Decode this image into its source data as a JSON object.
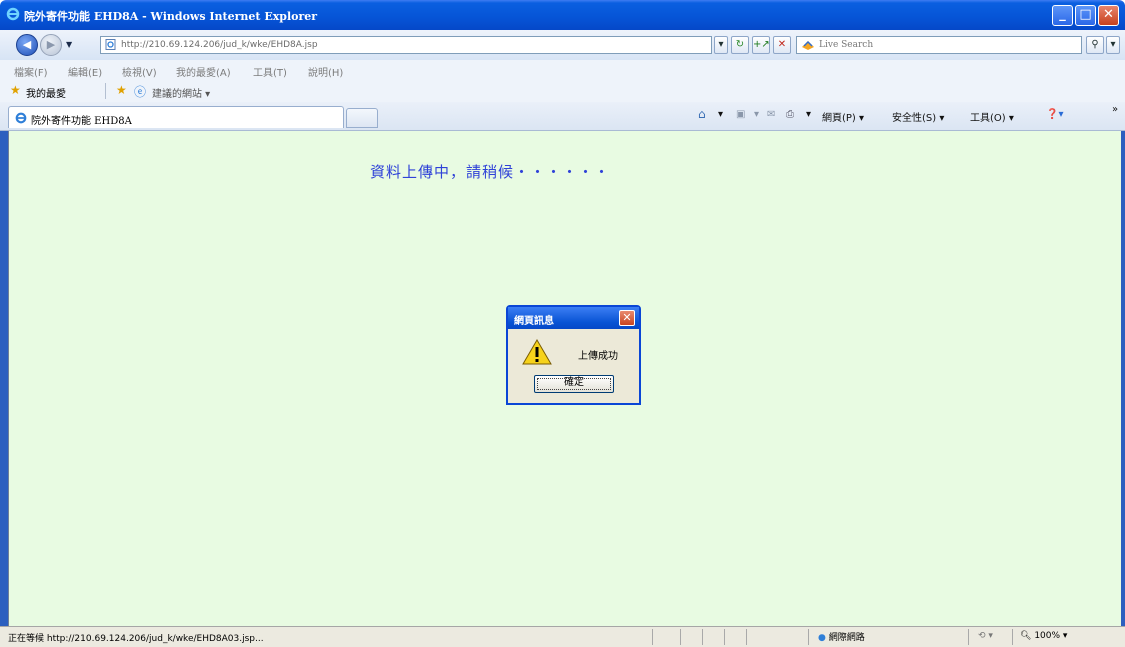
{
  "window": {
    "title": "院外寄件功能 EHD8A - Windows Internet Explorer",
    "minimize_label": "_",
    "maximize_label": "□",
    "close_label": "✕"
  },
  "address_bar": {
    "url": "http://210.69.124.206/jud_k/wke/EHD8A.jsp",
    "dropdown_label": "▾",
    "refresh_label": "↻",
    "go_label": "+↗",
    "stop_label": "✕"
  },
  "search": {
    "placeholder": "Live Search",
    "go_label": "⚲",
    "menu_label": "▾"
  },
  "menu": {
    "items": [
      "檔案(F)",
      "編輯(E)",
      "檢視(V)",
      "我的最愛(A)",
      "工具(T)",
      "說明(H)"
    ]
  },
  "favorites": {
    "label": "我的最愛",
    "suggested_sites": "建議的網站 ▾"
  },
  "tab": {
    "title": "院外寄件功能 EHD8A"
  },
  "command_bar": {
    "page": "網頁(P) ▾",
    "safety": "安全性(S) ▾",
    "tools": "工具(O) ▾",
    "more": "»"
  },
  "content": {
    "message": "資料上傳中，請稍候・・・・・・"
  },
  "dialog": {
    "title": "網頁訊息",
    "message": "上傳成功",
    "ok_label": "確定",
    "close_label": "✕"
  },
  "status": {
    "text": "正在等候 http://210.69.124.206/jud_k/wke/EHD8A03.jsp...",
    "zone": "網際網路",
    "zoom": "100%"
  },
  "colors": {
    "titlebar": "#0654d6",
    "content_bg": "#e8fbe2",
    "message_text": "#2f42d8",
    "dialog_bg": "#ece9d8"
  }
}
